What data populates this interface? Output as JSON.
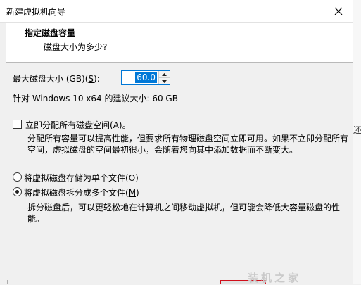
{
  "window": {
    "title": "新建虚拟机向导",
    "close_icon": "close-icon"
  },
  "header": {
    "title": "指定磁盘容量",
    "subtitle": "磁盘大小为多少?"
  },
  "disk_size": {
    "label_prefix": "最大磁盘大小 (GB)(",
    "label_key": "S",
    "label_suffix": "):",
    "value": "60.0",
    "recommended": "针对 Windows 10 x64 的建议大小: 60 GB"
  },
  "allocate": {
    "label_prefix": "立即分配所有磁盘空间(",
    "label_key": "A",
    "label_suffix": ")。",
    "checked": false,
    "description_line1": "分配所有容量可以提高性能，但要求所有物理磁盘空间立即可用。如果不立即分配所有",
    "description_line2": "空间，虚拟磁盘的空间最初很小，会随着您向其中添加数据而不断变大。"
  },
  "storage": {
    "single": {
      "label_prefix": "将虚拟磁盘存储为单个文件(",
      "label_key": "O",
      "label_suffix": ")",
      "checked": false
    },
    "multiple": {
      "label_prefix": "将虚拟磁盘拆分成多个文件(",
      "label_key": "M",
      "label_suffix": ")",
      "checked": true
    },
    "description_line1": "拆分磁盘后，可以更轻松地在计算机之间移动虚拟机，但可能会降低大容量磁盘的性",
    "description_line2": "能。"
  },
  "background": {
    "edge_text": "还",
    "watermark": "装机之家"
  },
  "colors": {
    "accent": "#0078d7",
    "focus_border": "#d10f1b"
  }
}
